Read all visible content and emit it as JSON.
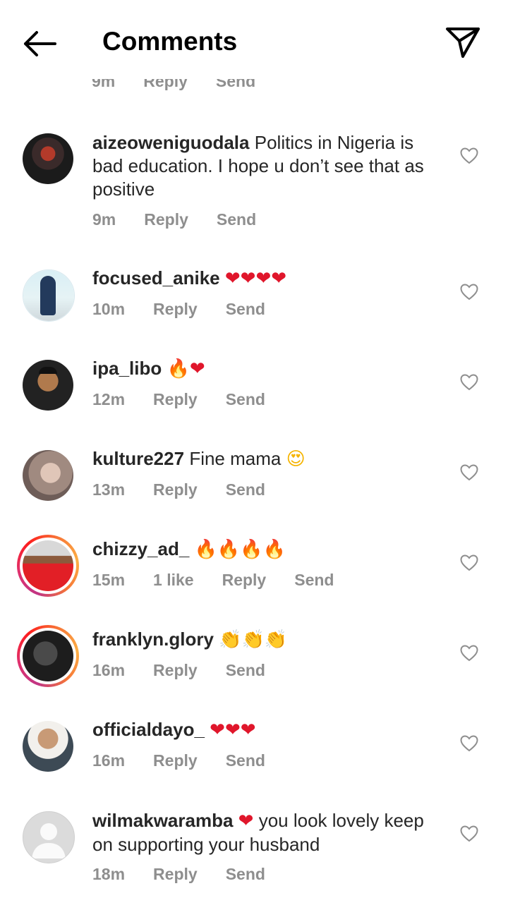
{
  "header": {
    "title": "Comments"
  },
  "partial": {
    "time": "9m",
    "reply": "Reply",
    "send": "Send"
  },
  "comments": [
    {
      "username": "aizeoweniguodala",
      "text": "Politics in Nigeria is bad education. I hope u don’t see that as positive",
      "time": "9m",
      "reply": "Reply",
      "send": "Send"
    },
    {
      "username": "focused_anike",
      "emoji": "❤❤❤❤",
      "time": "10m",
      "reply": "Reply",
      "send": "Send"
    },
    {
      "username": "ipa_libo",
      "emoji1": "🔥",
      "emoji2": "❤",
      "time": "12m",
      "reply": "Reply",
      "send": "Send"
    },
    {
      "username": "kulture227",
      "text": "Fine mama",
      "emoji": "😍",
      "time": "13m",
      "reply": "Reply",
      "send": "Send"
    },
    {
      "username": "chizzy_ad_",
      "emoji": "🔥🔥🔥🔥",
      "time": "15m",
      "likes": "1 like",
      "reply": "Reply",
      "send": "Send"
    },
    {
      "username": "franklyn.glory",
      "emoji": "👏👏👏",
      "time": "16m",
      "reply": "Reply",
      "send": "Send"
    },
    {
      "username": "officialdayo_",
      "emoji": "❤❤❤",
      "time": "16m",
      "reply": "Reply",
      "send": "Send"
    },
    {
      "username": "wilmakwaramba",
      "emoji": "❤",
      "text": "you look lovely keep on supporting your husband",
      "time": "18m",
      "reply": "Reply",
      "send": "Send"
    }
  ]
}
